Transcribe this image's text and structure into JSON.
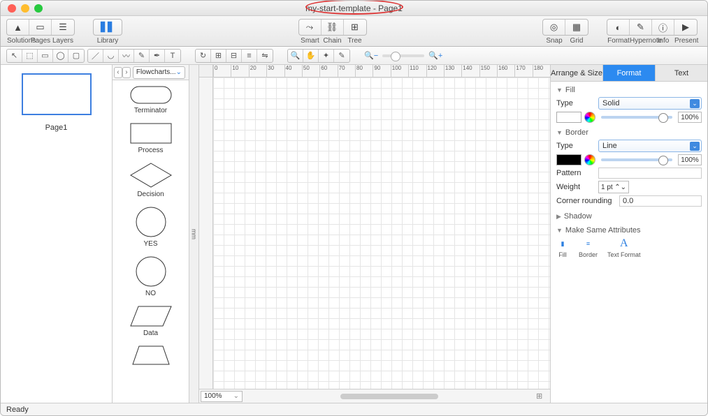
{
  "window": {
    "title": "my-start-template - Page1"
  },
  "toolbar": {
    "groups": [
      {
        "labels": [
          "Solutions",
          "Pages",
          "Layers"
        ]
      },
      {
        "label": "Library"
      }
    ],
    "center": {
      "labels": [
        "Smart",
        "Chain",
        "Tree"
      ]
    },
    "right": [
      {
        "labels": [
          "Snap",
          "Grid"
        ]
      },
      {
        "labels": [
          "Format",
          "Hypernote",
          "Info",
          "Present"
        ]
      }
    ]
  },
  "shapes": {
    "combo": "Flowcharts...",
    "items": [
      {
        "label": "Terminator"
      },
      {
        "label": "Process"
      },
      {
        "label": "Decision"
      },
      {
        "label": "YES"
      },
      {
        "label": "NO"
      },
      {
        "label": "Data"
      },
      {
        "label": ""
      }
    ]
  },
  "ruler_units": "mm",
  "page": {
    "name": "Page1"
  },
  "canvas": {
    "zoom": "100%"
  },
  "inspector": {
    "tabs": [
      "Arrange & Size",
      "Format",
      "Text"
    ],
    "active_tab": 1,
    "fill": {
      "section": "Fill",
      "type_label": "Type",
      "type_value": "Solid",
      "opacity": "100%"
    },
    "border": {
      "section": "Border",
      "type_label": "Type",
      "type_value": "Line",
      "opacity": "100%",
      "pattern_label": "Pattern",
      "weight_label": "Weight",
      "weight_value": "1 pt",
      "corner_label": "Corner rounding",
      "corner_value": "0.0"
    },
    "shadow": {
      "section": "Shadow"
    },
    "msa": {
      "section": "Make Same Attributes",
      "items": [
        "Fill",
        "Border",
        "Text Format"
      ]
    }
  },
  "status": {
    "text": "Ready"
  },
  "ruler_marks": [
    "0",
    "10",
    "20",
    "30",
    "40",
    "50",
    "60",
    "70",
    "80",
    "90",
    "100",
    "110",
    "120",
    "130",
    "140",
    "150",
    "160",
    "170",
    "180"
  ]
}
